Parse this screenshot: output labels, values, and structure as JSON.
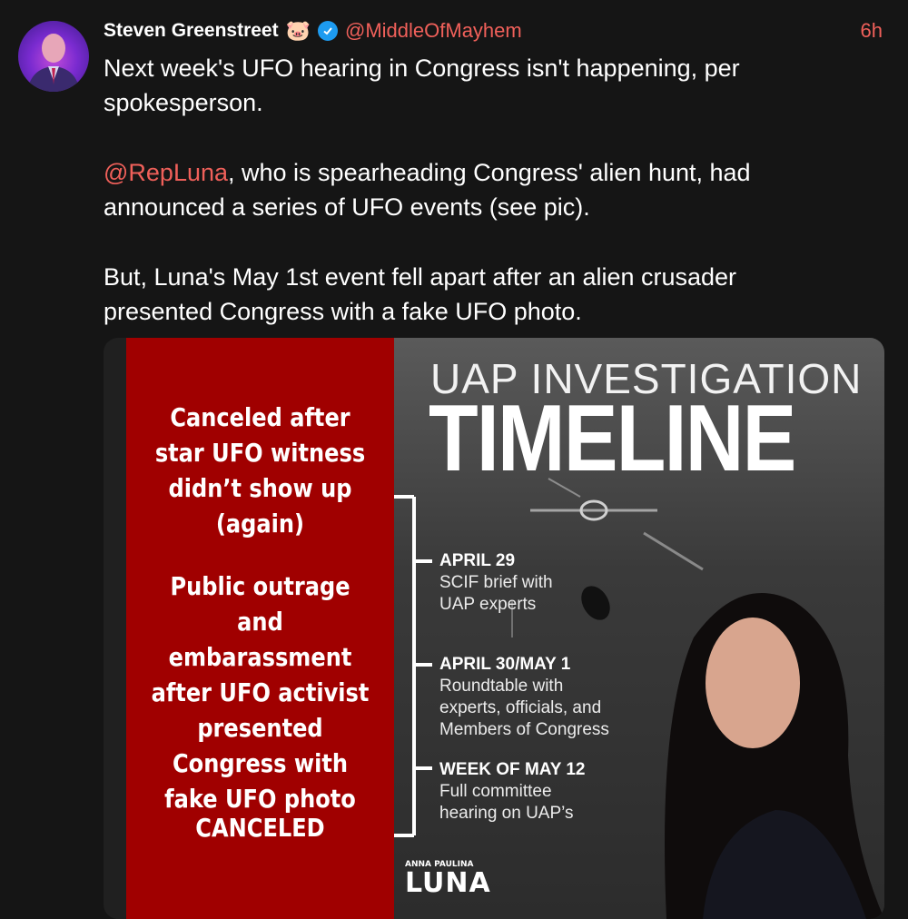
{
  "tweet": {
    "author_name": "Steven Greenstreet",
    "author_emoji": "🐷",
    "handle": "@MiddleOfMayhem",
    "time": "6h",
    "paragraph1": "Next week's UFO hearing in Congress isn't happening, per spokesperson.",
    "paragraph2_mention": "@RepLuna",
    "paragraph2_rest": ", who is spearheading Congress' alien hunt, had announced a series of UFO events (see pic).",
    "paragraph3": "But, Luna's May 1st event fell apart after an alien crusader presented Congress with a fake UFO photo."
  },
  "media": {
    "red_panel": {
      "note1": "Canceled after star UFO witness didn’t show up (again)",
      "note2": "Public outrage and embarassment after UFO activist presented Congress with fake UFO photo",
      "note3": "CANCELED"
    },
    "graphic": {
      "title_line1": "UAP INVESTIGATION",
      "title_line2": "TIMELINE",
      "entries": [
        {
          "date": "APRIL 29",
          "desc": "SCIF brief with UAP experts"
        },
        {
          "date": "APRIL 30/MAY 1",
          "desc": "Roundtable with experts, officials, and Members of Congress"
        },
        {
          "date": "WEEK OF MAY 12",
          "desc": "Full committee hearing on UAP’s"
        }
      ],
      "logo_small": "ANNA PAULINA",
      "logo_big": "LUNA"
    }
  },
  "colors": {
    "accent": "#f0605a",
    "background": "#151515",
    "verified": "#1d9bf0",
    "red_panel": "#a00000"
  }
}
